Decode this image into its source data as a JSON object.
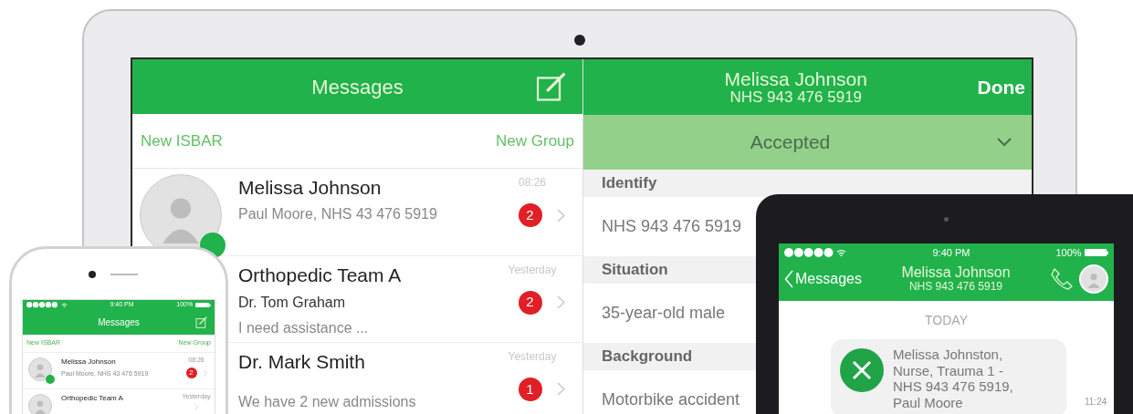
{
  "laptop": {
    "messages": {
      "title": "Messages",
      "actions": [
        "New ISBAR",
        "New Group"
      ],
      "conversations": [
        {
          "name": "Melissa Johnson",
          "lines": [
            {
              "kind": "preview",
              "text": "Paul Moore, NHS 43 476 5919"
            }
          ],
          "time": "08:26",
          "unread": "2",
          "online": true
        },
        {
          "name": "Orthopedic Team A",
          "lines": [
            {
              "kind": "sender",
              "text": "Dr. Tom Graham"
            },
            {
              "kind": "preview",
              "text": "I need assistance ..."
            }
          ],
          "time": "Yesterday",
          "unread": "2",
          "online": false
        },
        {
          "name": "Dr. Mark Smith",
          "lines": [
            {
              "kind": "preview",
              "text": "We have 2 new admissions"
            }
          ],
          "time": "Yesterday",
          "unread": "1",
          "online": false
        }
      ]
    },
    "detail": {
      "title": "Melissa Johnson",
      "subtitle": "NHS 943 476 5919",
      "done": "Done",
      "status": "Accepted",
      "sections": [
        {
          "heading": "Identify",
          "value": "NHS 943 476 5919"
        },
        {
          "heading": "Situation",
          "value": "35-year-old male"
        },
        {
          "heading": "Background",
          "value": "Motorbike accident"
        }
      ]
    }
  },
  "phone": {
    "status_bar": {
      "time": "9:40 PM",
      "battery": "100%"
    },
    "title": "Messages",
    "actions": [
      "New ISBAR",
      "New Group"
    ],
    "conversations": [
      {
        "name": "Melissa Johnson",
        "preview": "Paul Moore, NHS 43 476 5919",
        "time": "08:26",
        "unread": "2",
        "online": true
      },
      {
        "name": "Orthopedic Team A",
        "time": "Yesterday",
        "online": false
      }
    ]
  },
  "tablet": {
    "status_bar": {
      "time": "9:40 PM",
      "battery": "100%"
    },
    "back": "Messages",
    "title": "Melissa Johnson",
    "subtitle": "NHS 943 476 5919",
    "day": "TODAY",
    "message": {
      "text": "Melissa Johnston, Nurse, Trauma 1 - NHS 943 476 5919, Paul Moore",
      "time": "11:24"
    }
  }
}
